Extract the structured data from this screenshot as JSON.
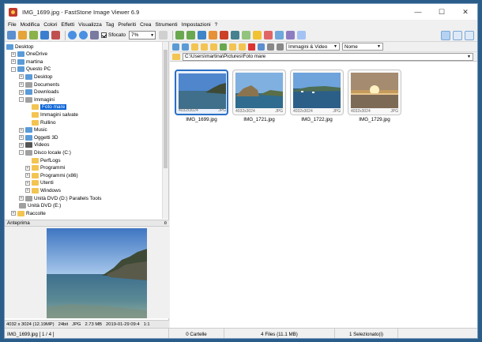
{
  "window": {
    "title": "IMG_1699.jpg - FastStone Image Viewer 6.9",
    "controls": {
      "minimize": "—",
      "maximize": "☐",
      "close": "✕"
    }
  },
  "menu": [
    "File",
    "Modifica",
    "Colori",
    "Effetti",
    "Visualizza",
    "Tag",
    "Preferiti",
    "Crea",
    "Strumenti",
    "Impostazioni",
    "?"
  ],
  "toolbar": {
    "smooth_label": "Sfocato",
    "zoom_value": "7%"
  },
  "tree": {
    "items": [
      {
        "label": "Desktop",
        "x": 2,
        "exp": "",
        "icon": "blue"
      },
      {
        "label": "OneDrive",
        "x": 8,
        "exp": "+",
        "icon": "blue"
      },
      {
        "label": "martina",
        "x": 8,
        "exp": "+",
        "icon": "blue"
      },
      {
        "label": "Questo PC",
        "x": 8,
        "exp": "-",
        "icon": "blue"
      },
      {
        "label": "Desktop",
        "x": 18,
        "exp": "+",
        "icon": "blue"
      },
      {
        "label": "Documents",
        "x": 18,
        "exp": "+",
        "icon": "grey"
      },
      {
        "label": "Downloads",
        "x": 18,
        "exp": "+",
        "icon": "blue"
      },
      {
        "label": "Immagini",
        "x": 18,
        "exp": "-",
        "icon": "grey"
      },
      {
        "label": "Foto mare",
        "x": 34,
        "exp": "",
        "icon": "",
        "selected": true
      },
      {
        "label": "Immagini salvate",
        "x": 34,
        "exp": "",
        "icon": ""
      },
      {
        "label": "Rullino",
        "x": 34,
        "exp": "",
        "icon": ""
      },
      {
        "label": "Music",
        "x": 18,
        "exp": "+",
        "icon": "blue"
      },
      {
        "label": "Oggetti 3D",
        "x": 18,
        "exp": "+",
        "icon": "blue"
      },
      {
        "label": "Videos",
        "x": 18,
        "exp": "+",
        "icon": "dark"
      },
      {
        "label": "Disco locale (C:)",
        "x": 18,
        "exp": "-",
        "icon": "grey"
      },
      {
        "label": "PerfLogs",
        "x": 34,
        "exp": "",
        "icon": "yellow"
      },
      {
        "label": "Programmi",
        "x": 26,
        "exp": "+",
        "icon": "yellow"
      },
      {
        "label": "Programmi (x86)",
        "x": 26,
        "exp": "+",
        "icon": "yellow"
      },
      {
        "label": "Utenti",
        "x": 26,
        "exp": "+",
        "icon": "yellow"
      },
      {
        "label": "Windows",
        "x": 26,
        "exp": "+",
        "icon": "yellow"
      },
      {
        "label": "Unità DVD (D:) Parallels Tools",
        "x": 18,
        "exp": "+",
        "icon": "grey"
      },
      {
        "label": "Unità DVD (E:)",
        "x": 18,
        "exp": "",
        "icon": "grey"
      },
      {
        "label": "Raccolte",
        "x": 8,
        "exp": "+",
        "icon": "yellow"
      }
    ]
  },
  "preview": {
    "header": "Anteprima",
    "info": [
      "4032 x 3024 (12.19MP)",
      "24bit",
      "JPG",
      "2.73 MB",
      "2019-01-29 09:4",
      "1:1"
    ]
  },
  "browser": {
    "filter": "Immagini & Video",
    "sort": "Nome",
    "path": "C:\\Users\\martina\\Pictures\\Foto mare"
  },
  "thumbnails": [
    {
      "name": "IMG_1699.jpg",
      "dims": "4032x3024",
      "type": "JPG",
      "selected": true,
      "scene": "sea1"
    },
    {
      "name": "IMG_1721.jpg",
      "dims": "4032x3024",
      "type": "JPG",
      "selected": false,
      "scene": "coast"
    },
    {
      "name": "IMG_1722.jpg",
      "dims": "4032x3024",
      "type": "JPG",
      "selected": false,
      "scene": "harbor"
    },
    {
      "name": "IMG_1729.jpg",
      "dims": "4032x3024",
      "type": "JPG",
      "selected": false,
      "scene": "sunset"
    }
  ],
  "status": {
    "file": "IMG_1699.jpg [ 1 / 4 ]",
    "folders": "0 Cartelle",
    "files": "4 Files (11.1 MB)",
    "selected": "1 Selezionato(i)"
  },
  "colors": {
    "selection": "#0a64d6",
    "thumb_selected_border": "#2a6fc4",
    "folder": "#f3c452"
  }
}
